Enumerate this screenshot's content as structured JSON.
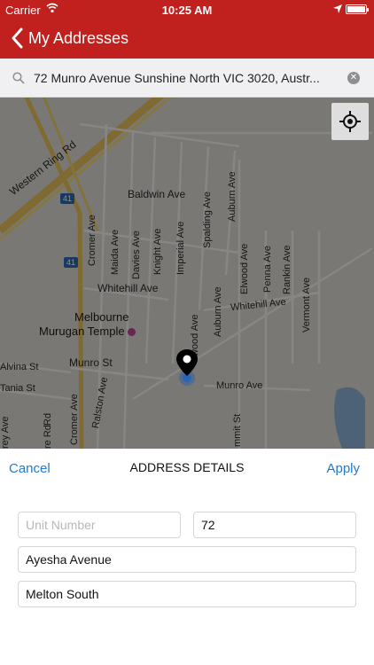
{
  "status_bar": {
    "carrier": "Carrier",
    "time": "10:25 AM"
  },
  "nav": {
    "title": "My Addresses"
  },
  "search": {
    "value": "72 Munro Avenue Sunshine North VIC 3020, Austr..."
  },
  "map": {
    "labels": {
      "western_ring_rd": "Western Ring Rd",
      "baldwin_ave": "Baldwin Ave",
      "auburn_ave_top": "Auburn Ave",
      "spalding_ave": "Spalding Ave",
      "cromer_ave": "Cromer Ave",
      "maida_ave": "Maida Ave",
      "davies_ave": "Davies Ave",
      "knight_ave": "Knight Ave",
      "imperial_ave": "Imperial Ave",
      "whitehill_ave_left": "Whitehill Ave",
      "elwood_ave_right": "Elwood Ave",
      "penna_ave": "Penna Ave",
      "rankin_ave": "Rankin Ave",
      "vermont_ave": "Vermont Ave",
      "whitehill_ave_right": "Whitehill Ave",
      "auburn_ave_mid": "Auburn Ave",
      "elwood_ave_mid": "wood Ave",
      "munro_st": "Munro St",
      "munro_ave": "Munro Ave",
      "alvina_st": "Alvina St",
      "tania_st": "Tania St",
      "ralston_ave": "Ralston Ave",
      "cromer_ave_low": "Cromer Ave",
      "road_re": "re Rd",
      "road_rd": "Rd",
      "harvey_ave": "rey Ave",
      "summit_st": "mmit St",
      "shield_41_top": "41",
      "shield_41_low": "41"
    },
    "poi": "Melbourne\nMurugan Temple"
  },
  "details": {
    "cancel": "Cancel",
    "heading": "ADDRESS DETAILS",
    "apply": "Apply",
    "unit_placeholder": "Unit Number",
    "unit_value": "",
    "street_number": "72",
    "street_name": "Ayesha Avenue",
    "suburb": "Melton South"
  },
  "colors": {
    "accent": "#c0201e",
    "link": "#1f7ad1"
  },
  "icons": [
    "back-chevron-icon",
    "search-icon",
    "clear-icon",
    "locate-icon",
    "map-pin-icon",
    "wifi-icon",
    "location-arrow-icon",
    "battery-icon"
  ]
}
